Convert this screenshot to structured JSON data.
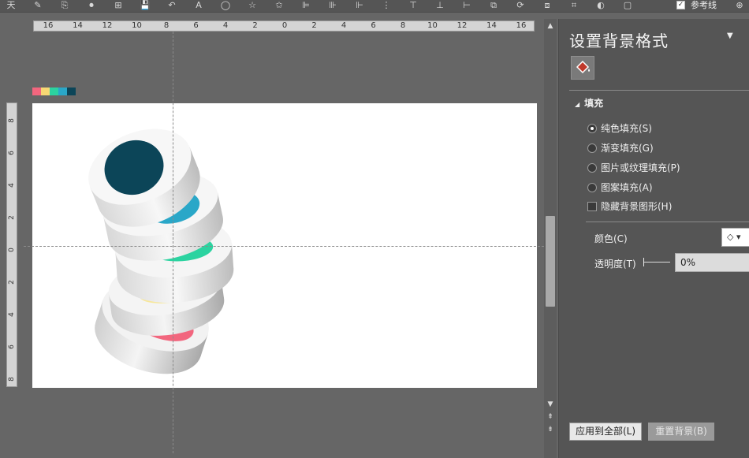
{
  "toolbar": {
    "reference_line_label": "参考线",
    "reference_line_checked": true,
    "icons": [
      "text-icon",
      "brush-icon",
      "paste-icon",
      "record-icon",
      "grid-icon",
      "save-icon",
      "undo-icon",
      "textbox-icon",
      "shape-icon",
      "star-icon",
      "star-outline-icon",
      "align-left-icon",
      "align-center-icon",
      "align-right-icon",
      "distribute-icon",
      "align-top-icon",
      "align-middle-icon",
      "align-bottom-icon",
      "group-icon",
      "rotate-icon",
      "arrange-icon",
      "crop-icon",
      "effect-icon",
      "frame-icon",
      "add-icon"
    ]
  },
  "ruler": {
    "h_labels": [
      "16",
      "14",
      "12",
      "10",
      "8",
      "6",
      "4",
      "2",
      "0",
      "2",
      "4",
      "6",
      "8",
      "10",
      "12",
      "14",
      "16"
    ],
    "v_labels": [
      "8",
      "6",
      "4",
      "2",
      "0",
      "2",
      "4",
      "6",
      "8"
    ]
  },
  "palette": [
    "#f2667e",
    "#f7d774",
    "#2bd3a0",
    "#2aa7c8",
    "#0c4558"
  ],
  "panel": {
    "title": "设置背景格式",
    "section": "填充",
    "options": [
      {
        "label": "纯色填充(S)",
        "selected": true
      },
      {
        "label": "渐变填充(G)",
        "selected": false
      },
      {
        "label": "图片或纹理填充(P)",
        "selected": false
      },
      {
        "label": "图案填充(A)",
        "selected": false
      }
    ],
    "hide_bg_graphics": "隐藏背景图形(H)",
    "color_label": "颜色(C)",
    "transparency_label": "透明度(T)",
    "transparency_value": "0%",
    "apply_all": "应用到全部(L)",
    "reset_bg": "重置背景(B)"
  }
}
